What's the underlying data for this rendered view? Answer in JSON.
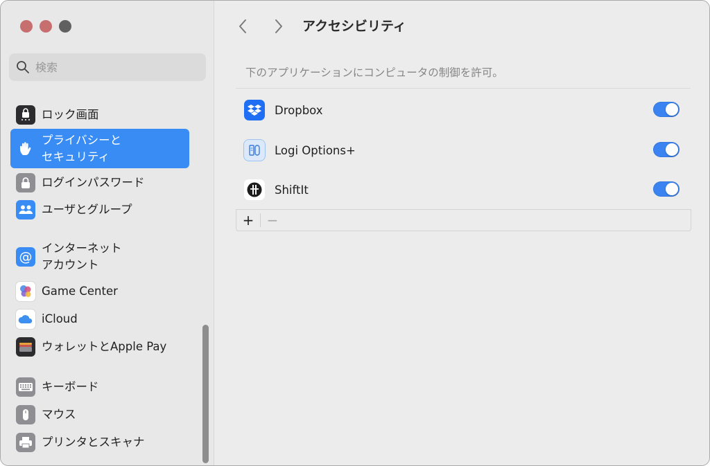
{
  "window": {
    "traffic_lights": [
      "close",
      "minimize",
      "zoom"
    ]
  },
  "search": {
    "placeholder": "検索",
    "icon": "magnifier-icon"
  },
  "sidebar": {
    "items": [
      {
        "label": "ロック画面",
        "icon": "lock-screen-icon",
        "color": "#2c2c2e"
      },
      {
        "label": "プライバシーと\nセキュリティ",
        "icon": "hand-icon",
        "color": "#3a8cf5",
        "active": true
      },
      {
        "label": "ログインパスワード",
        "icon": "padlock-icon",
        "color": "#8e8e93"
      },
      {
        "label": "ユーザとグループ",
        "icon": "users-icon",
        "color": "#3a8cf5"
      },
      {
        "label": "インターネット\nアカウント",
        "icon": "at-icon",
        "color": "#3a8cf5"
      },
      {
        "label": "Game Center",
        "icon": "game-center-icon",
        "color": "#ffffff"
      },
      {
        "label": "iCloud",
        "icon": "cloud-icon",
        "color": "#ffffff"
      },
      {
        "label": "ウォレットとApple Pay",
        "icon": "wallet-icon",
        "color": "#2c2c2e"
      },
      {
        "label": "キーボード",
        "icon": "keyboard-icon",
        "color": "#8e8e93"
      },
      {
        "label": "マウス",
        "icon": "mouse-icon",
        "color": "#8e8e93"
      },
      {
        "label": "プリンタとスキャナ",
        "icon": "printer-icon",
        "color": "#8e8e93"
      }
    ]
  },
  "main": {
    "title": "アクセシビリティ",
    "caption": "下のアプリケーションにコンピュータの制御を許可。",
    "apps": [
      {
        "name": "Dropbox",
        "icon": "dropbox-icon",
        "enabled": true
      },
      {
        "name": "Logi Options+",
        "icon": "logi-options-icon",
        "enabled": true
      },
      {
        "name": "ShiftIt",
        "icon": "shiftit-icon",
        "enabled": true
      }
    ],
    "add_label": "+",
    "remove_label": "−"
  },
  "colors": {
    "accent": "#3a8cf5",
    "toggle_on": "#3a83f0",
    "sidebar_bg": "#e9e8e9",
    "main_bg": "#ececec"
  }
}
